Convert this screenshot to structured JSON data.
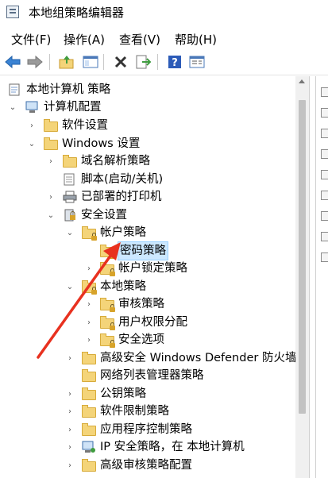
{
  "window": {
    "title": "本地组策略编辑器"
  },
  "menu": [
    {
      "label": "文件(F)"
    },
    {
      "label": "操作(A)"
    },
    {
      "label": "查看(V)"
    },
    {
      "label": "帮助(H)"
    }
  ],
  "toolbar": {
    "buttons": [
      {
        "icon": "back-arrow-icon"
      },
      {
        "icon": "forward-arrow-icon"
      },
      {
        "icon": "up-folder-icon"
      },
      {
        "icon": "show-hide-tree-icon"
      },
      {
        "icon": "delete-x-icon"
      },
      {
        "icon": "export-list-icon"
      },
      {
        "icon": "help-icon"
      },
      {
        "icon": "properties-icon"
      }
    ]
  },
  "tree": {
    "root": "本地计算机 策略",
    "computer_config": "计算机配置",
    "software_settings": "软件设置",
    "windows_settings": "Windows 设置",
    "name_resolution": "域名解析策略",
    "scripts": "脚本(启动/关机)",
    "printers": "已部署的打印机",
    "security_settings": "安全设置",
    "account_policies": "帐户策略",
    "password_policy": "密码策略",
    "lockout_policy": "帐户锁定策略",
    "local_policies": "本地策略",
    "audit_policy": "审核策略",
    "user_rights": "用户权限分配",
    "security_options": "安全选项",
    "defender_firewall": "高级安全 Windows Defender 防火墙",
    "network_list": "网络列表管理器策略",
    "public_key": "公钥策略",
    "software_restriction": "软件限制策略",
    "app_control": "应用程序控制策略",
    "ip_security": "IP 安全策略，在 本地计算机",
    "advanced_audit": "高级审核策略配置"
  }
}
